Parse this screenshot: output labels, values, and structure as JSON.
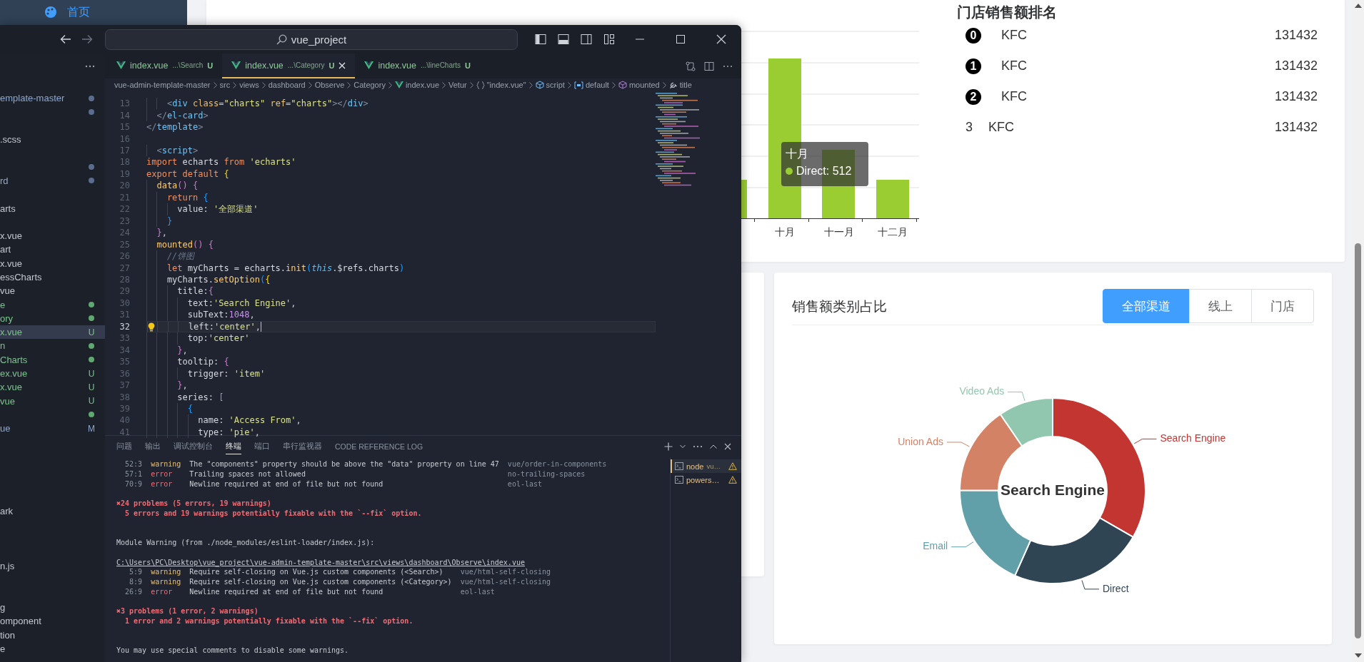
{
  "page_sidebar": {
    "items": [
      {
        "label": "首页",
        "selected": true
      }
    ]
  },
  "vscode": {
    "command_center": {
      "title": "vue_project"
    },
    "explorer": {
      "items": [
        {
          "label": "emplate-master",
          "dot": true,
          "kind": "modified",
          "selected": false
        },
        {
          "dot": true,
          "kind": "modified",
          "selected": false
        },
        {
          "selected": false
        },
        {
          "label": ".scss",
          "kind": "plain",
          "selected": false
        },
        {
          "selected": false
        },
        {
          "dot": true,
          "kind": "modified",
          "selected": false
        },
        {
          "label": "rd",
          "dot": true,
          "kind": "modified",
          "selected": false
        },
        {
          "selected": false
        },
        {
          "label": "arts",
          "kind": "plain",
          "selected": false
        },
        {
          "selected": false
        },
        {
          "label": "x.vue",
          "kind": "plain",
          "selected": false
        },
        {
          "label": "art",
          "kind": "plain",
          "selected": false
        },
        {
          "label": "x.vue",
          "kind": "plain",
          "selected": false
        },
        {
          "label": "essCharts",
          "kind": "plain",
          "selected": false
        },
        {
          "label": "vue",
          "kind": "plain",
          "selected": false
        },
        {
          "label": "e",
          "dot": true,
          "kind": "untracked",
          "selected": false
        },
        {
          "label": "ory",
          "dot": true,
          "kind": "untracked",
          "selected": false
        },
        {
          "label": "x.vue",
          "badge": "U",
          "kind": "untracked",
          "selected": true
        },
        {
          "label": "n",
          "dot": true,
          "kind": "untracked",
          "selected": false
        },
        {
          "label": "Charts",
          "dot": true,
          "kind": "untracked",
          "selected": false
        },
        {
          "label": "ex.vue",
          "badge": "U",
          "kind": "untracked",
          "selected": false
        },
        {
          "label": "x.vue",
          "badge": "U",
          "kind": "untracked",
          "selected": false
        },
        {
          "label": "vue",
          "badge": "U",
          "kind": "untracked",
          "selected": false
        },
        {
          "dot": true,
          "kind": "untracked",
          "selected": false
        },
        {
          "label": "ue",
          "badge": "M",
          "kind": "modified",
          "selected": false
        },
        {
          "selected": false
        },
        {
          "selected": false
        },
        {
          "selected": false
        },
        {
          "selected": false
        },
        {
          "selected": false
        },
        {
          "label": "ark",
          "kind": "plain",
          "selected": false
        },
        {
          "selected": false
        },
        {
          "selected": false
        },
        {
          "selected": false
        },
        {
          "label": "n.js",
          "kind": "plain",
          "selected": false
        },
        {
          "selected": false
        },
        {
          "selected": false
        },
        {
          "label": "g",
          "kind": "plain",
          "selected": false
        },
        {
          "label": "omponent",
          "kind": "plain",
          "selected": false
        },
        {
          "label": "tion",
          "kind": "plain",
          "selected": false
        },
        {
          "label": "e",
          "kind": "plain",
          "selected": false
        }
      ]
    },
    "tabs": [
      {
        "name": "index.vue",
        "folder": "...\\Search",
        "badge": "U",
        "selected": false
      },
      {
        "name": "index.vue",
        "folder": "...\\Category",
        "badge": "U",
        "selected": true
      },
      {
        "name": "index.vue",
        "folder": "...\\lineCharts",
        "badge": "U",
        "selected": false
      }
    ],
    "breadcrumbs": [
      {
        "label": "vue-admin-template-master"
      },
      {
        "label": "src"
      },
      {
        "label": "views"
      },
      {
        "label": "dashboard"
      },
      {
        "label": "Observe"
      },
      {
        "label": "Category"
      },
      {
        "label": "index.vue",
        "kind": "vue"
      },
      {
        "label": "Vetur"
      },
      {
        "label": "\"index.vue\"",
        "kind": "braces"
      },
      {
        "label": "script",
        "kind": "module"
      },
      {
        "label": "default",
        "kind": "field"
      },
      {
        "label": "mounted",
        "kind": "method"
      },
      {
        "label": "title",
        "kind": "property"
      }
    ],
    "editor": {
      "lines": [
        {
          "number": "13",
          "tokens": [
            {
              "kind": "ang",
              "text": "    <"
            },
            {
              "kind": "tag",
              "text": "div"
            },
            {
              "kind": "attr",
              "text": " class"
            },
            {
              "kind": "op",
              "text": "="
            },
            {
              "kind": "str",
              "text": "\"charts\""
            },
            {
              "kind": "attr",
              "text": " ref"
            },
            {
              "kind": "op",
              "text": "="
            },
            {
              "kind": "str",
              "text": "\"charts\""
            },
            {
              "kind": "ang",
              "text": "></"
            },
            {
              "kind": "tag",
              "text": "div"
            },
            {
              "kind": "ang",
              "text": ">"
            }
          ],
          "current": false
        },
        {
          "number": "14",
          "tokens": [
            {
              "kind": "ang",
              "text": "  </"
            },
            {
              "kind": "tag",
              "text": "el-card"
            },
            {
              "kind": "ang",
              "text": ">"
            }
          ],
          "current": false
        },
        {
          "number": "15",
          "tokens": [
            {
              "kind": "ang",
              "text": "</"
            },
            {
              "kind": "tag",
              "text": "template"
            },
            {
              "kind": "ang",
              "text": ">"
            }
          ],
          "current": false
        },
        {
          "number": "16",
          "current": false
        },
        {
          "number": "17",
          "tokens": [
            {
              "kind": "ang",
              "text": "  <"
            },
            {
              "kind": "tag",
              "text": "script"
            },
            {
              "kind": "ang",
              "text": ">"
            }
          ],
          "current": false
        },
        {
          "number": "18",
          "tokens": [
            {
              "kind": "kw",
              "text": "import"
            },
            {
              "kind": "id",
              "text": " echarts "
            },
            {
              "kind": "kw",
              "text": "from"
            },
            {
              "kind": "str",
              "text": " 'echarts'"
            }
          ],
          "current": false
        },
        {
          "number": "19",
          "tokens": [
            {
              "kind": "kw",
              "text": "export default "
            },
            {
              "kind": "b1",
              "text": "{"
            }
          ],
          "current": false
        },
        {
          "number": "20",
          "tokens": [
            {
              "kind": "fn",
              "text": "  data"
            },
            {
              "kind": "b2",
              "text": "() {"
            }
          ],
          "current": false
        },
        {
          "number": "21",
          "tokens": [
            {
              "kind": "kw",
              "text": "    return "
            },
            {
              "kind": "b3",
              "text": "{"
            }
          ],
          "current": false
        },
        {
          "number": "22",
          "tokens": [
            {
              "kind": "id",
              "text": "      value: "
            },
            {
              "kind": "str",
              "text": "'全部渠道'"
            }
          ],
          "current": false
        },
        {
          "number": "23",
          "tokens": [
            {
              "kind": "b3",
              "text": "    }"
            }
          ],
          "current": false
        },
        {
          "number": "24",
          "tokens": [
            {
              "kind": "b2",
              "text": "  }"
            },
            {
              "kind": "op",
              "text": ","
            }
          ],
          "current": false
        },
        {
          "number": "25",
          "tokens": [
            {
              "kind": "fn",
              "text": "  mounted"
            },
            {
              "kind": "b2",
              "text": "() {"
            }
          ],
          "current": false
        },
        {
          "number": "26",
          "tokens": [
            {
              "kind": "cmt",
              "text": "    //饼图"
            }
          ],
          "current": false
        },
        {
          "number": "27",
          "tokens": [
            {
              "kind": "kw",
              "text": "    let"
            },
            {
              "kind": "id",
              "text": " myCharts = echarts."
            },
            {
              "kind": "fn",
              "text": "init"
            },
            {
              "kind": "b3",
              "text": "("
            },
            {
              "kind": "this",
              "text": "this"
            },
            {
              "kind": "id",
              "text": ".$refs.charts"
            },
            {
              "kind": "b3",
              "text": ")"
            }
          ],
          "current": false
        },
        {
          "number": "28",
          "tokens": [
            {
              "kind": "id",
              "text": "    myCharts."
            },
            {
              "kind": "fn",
              "text": "setOption"
            },
            {
              "kind": "b3",
              "text": "("
            },
            {
              "kind": "b1",
              "text": "{"
            }
          ],
          "current": false
        },
        {
          "number": "29",
          "tokens": [
            {
              "kind": "id",
              "text": "      title:"
            },
            {
              "kind": "b2",
              "text": "{"
            }
          ],
          "current": false
        },
        {
          "number": "30",
          "tokens": [
            {
              "kind": "id",
              "text": "        text:"
            },
            {
              "kind": "str",
              "text": "'Search Engine'"
            },
            {
              "kind": "op",
              "text": ","
            }
          ],
          "current": false
        },
        {
          "number": "31",
          "tokens": [
            {
              "kind": "id",
              "text": "        subText:"
            },
            {
              "kind": "num",
              "text": "1048"
            },
            {
              "kind": "op",
              "text": ","
            }
          ],
          "current": false
        },
        {
          "number": "32",
          "tokens": [
            {
              "kind": "id",
              "text": "        left:"
            },
            {
              "kind": "str",
              "text": "'center'"
            },
            {
              "kind": "op",
              "text": ","
            }
          ],
          "current": true
        },
        {
          "number": "33",
          "tokens": [
            {
              "kind": "id",
              "text": "        top:"
            },
            {
              "kind": "str",
              "text": "'center'"
            }
          ],
          "current": false
        },
        {
          "number": "34",
          "tokens": [
            {
              "kind": "b2",
              "text": "      }"
            },
            {
              "kind": "op",
              "text": ","
            }
          ],
          "current": false
        },
        {
          "number": "35",
          "tokens": [
            {
              "kind": "id",
              "text": "      tooltip: "
            },
            {
              "kind": "b2",
              "text": "{"
            }
          ],
          "current": false
        },
        {
          "number": "36",
          "tokens": [
            {
              "kind": "id",
              "text": "        trigger: "
            },
            {
              "kind": "str",
              "text": "'item'"
            }
          ],
          "current": false
        },
        {
          "number": "37",
          "tokens": [
            {
              "kind": "b2",
              "text": "      }"
            },
            {
              "kind": "op",
              "text": ","
            }
          ],
          "current": false
        },
        {
          "number": "38",
          "tokens": [
            {
              "kind": "id",
              "text": "      series: "
            },
            {
              "kind": "b2",
              "text": "["
            }
          ],
          "current": false
        },
        {
          "number": "39",
          "tokens": [
            {
              "kind": "b3",
              "text": "        {"
            }
          ],
          "current": false
        },
        {
          "number": "40",
          "tokens": [
            {
              "kind": "id",
              "text": "          name: "
            },
            {
              "kind": "str",
              "text": "'Access From'"
            },
            {
              "kind": "op",
              "text": ","
            }
          ],
          "current": false
        },
        {
          "number": "41",
          "tokens": [
            {
              "kind": "id",
              "text": "          type: "
            },
            {
              "kind": "str",
              "text": "'pie'"
            },
            {
              "kind": "op",
              "text": ","
            }
          ],
          "current": false
        }
      ]
    },
    "panel": {
      "tabs": [
        {
          "label": "问题",
          "selected": false
        },
        {
          "label": "输出",
          "selected": false
        },
        {
          "label": "调试控制台",
          "selected": false
        },
        {
          "label": "终端",
          "selected": true
        },
        {
          "label": "端口",
          "selected": false
        },
        {
          "label": "串行监视器",
          "selected": false
        },
        {
          "label": "CODE REFERENCE LOG",
          "selected": false
        }
      ],
      "lines": [
        {
          "kind": "lint",
          "rows": [
            {
              "pos": "52:3",
              "kind": "warning",
              "label": "warning",
              "message": "The \"components\" property should be above the \"data\" property on line 47",
              "rule": "vue/order-in-components"
            },
            {
              "pos": "57:1",
              "kind": "error",
              "label": "error",
              "message": "Trailing spaces not allowed",
              "rule": "no-trailing-spaces"
            },
            {
              "pos": "70:9",
              "kind": "error",
              "label": "error",
              "message": "Newline required at end of file but not found",
              "rule": "eol-last"
            }
          ]
        },
        {
          "kind": "blank"
        },
        {
          "kind": "summary",
          "text": "✖24 problems (5 errors, 19 warnings)"
        },
        {
          "kind": "hint",
          "text": "5 errors and 19 warnings potentially fixable with the `--fix` option."
        },
        {
          "kind": "blank"
        },
        {
          "kind": "blank"
        },
        {
          "kind": "plain",
          "text": "Module Warning (from ./node_modules/eslint-loader/index.js):"
        },
        {
          "kind": "blank"
        },
        {
          "kind": "path",
          "text": "C:\\Users\\PC\\Desktop\\vue_project\\vue-admin-template-master\\src\\views\\dashboard\\Observe\\index.vue"
        },
        {
          "kind": "lint",
          "rows": [
            {
              "pos": "5:9",
              "kind": "warning",
              "label": "warning",
              "message": "Require self-closing on Vue.js custom components (<Search>)",
              "rule": "vue/html-self-closing"
            },
            {
              "pos": "8:9",
              "kind": "warning",
              "label": "warning",
              "message": "Require self-closing on Vue.js custom components (<Category>)",
              "rule": "vue/html-self-closing"
            },
            {
              "pos": "26:9",
              "kind": "error",
              "label": "error",
              "message": "Newline required at end of file but not found",
              "rule": "eol-last"
            }
          ]
        },
        {
          "kind": "blank"
        },
        {
          "kind": "summary",
          "text": "✖3 problems (1 error, 2 warnings)"
        },
        {
          "kind": "hint",
          "text": "1 error and 2 warnings potentially fixable with the `--fix` option."
        },
        {
          "kind": "blank"
        },
        {
          "kind": "blank"
        },
        {
          "kind": "plain",
          "text": "You may use special comments to disable some warnings."
        }
      ],
      "terminals": [
        {
          "label": "node",
          "detail": "vu…",
          "selected": true
        },
        {
          "label": "powers…",
          "selected": false
        }
      ]
    }
  },
  "sales_chart": {
    "x_labels": [
      "十月",
      "十一月",
      "十二月"
    ],
    "tooltip": {
      "title": "十月",
      "value": "Direct: 512"
    }
  },
  "ranking": {
    "title": "门店销售额排名",
    "rows": [
      {
        "rank": "0",
        "name": "KFC",
        "value": "131432",
        "highlighted": true
      },
      {
        "rank": "1",
        "name": "KFC",
        "value": "131432",
        "highlighted": true
      },
      {
        "rank": "2",
        "name": "KFC",
        "value": "131432",
        "highlighted": true
      },
      {
        "rank": "3",
        "name": "KFC",
        "value": "131432",
        "highlighted": false
      }
    ]
  },
  "category_card": {
    "title": "销售额类别占比",
    "options": [
      {
        "label": "全部渠道",
        "selected": true
      },
      {
        "label": "线上",
        "selected": false
      },
      {
        "label": "门店",
        "selected": false
      }
    ],
    "center_label": "Search Engine",
    "slices": [
      {
        "label": "Search Engine",
        "color": "#c23531"
      },
      {
        "label": "Direct",
        "color": "#2f4554"
      },
      {
        "label": "Email",
        "color": "#61a0a8"
      },
      {
        "label": "Union Ads",
        "color": "#d48265"
      },
      {
        "label": "Video Ads",
        "color": "#91c7ae"
      }
    ]
  }
}
